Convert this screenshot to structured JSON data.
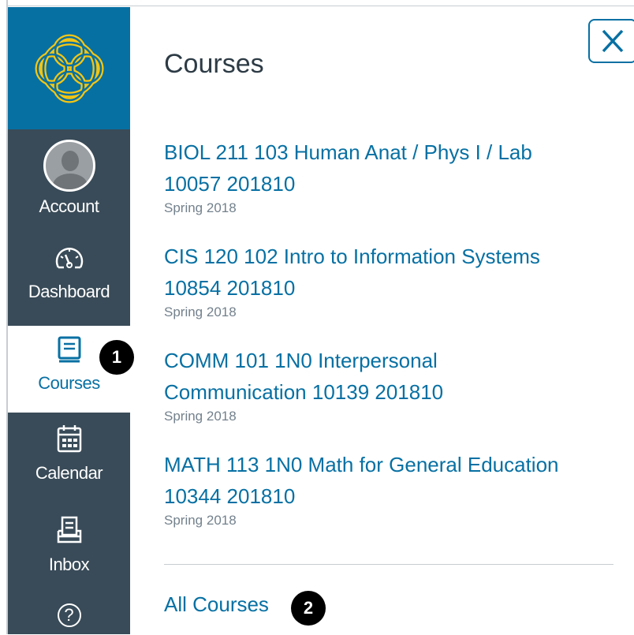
{
  "nav": {
    "items": [
      {
        "label": "Account",
        "icon": "avatar-icon"
      },
      {
        "label": "Dashboard",
        "icon": "dashboard-gauge-icon"
      },
      {
        "label": "Courses",
        "icon": "courses-book-icon",
        "active": true
      },
      {
        "label": "Calendar",
        "icon": "calendar-icon"
      },
      {
        "label": "Inbox",
        "icon": "inbox-icon"
      },
      {
        "label": "",
        "icon": "help-icon"
      }
    ],
    "help_glyph": "?"
  },
  "tray": {
    "title": "Courses",
    "courses": [
      {
        "name_line1": "BIOL 211 103 Human Anat / Phys I / Lab",
        "name_line2": "10057 201810",
        "term": "Spring 2018"
      },
      {
        "name_line1": "CIS 120 102 Intro to Information Systems",
        "name_line2": "10854 201810",
        "term": "Spring 2018"
      },
      {
        "name_line1": "COMM 101 1N0 Interpersonal",
        "name_line2": "Communication 10139 201810",
        "term": "Spring 2018"
      },
      {
        "name_line1": "MATH 113 1N0 Math for General Education",
        "name_line2": "10344 201810",
        "term": "Spring 2018"
      }
    ],
    "all_courses_label": "All Courses"
  },
  "badges": {
    "one": "1",
    "two": "2"
  },
  "colors": {
    "nav_bg": "#394b58",
    "brand_blue": "#0770a3",
    "logo_gold": "#f6c611",
    "text_dark": "#2d3b45",
    "muted": "#73818c"
  }
}
